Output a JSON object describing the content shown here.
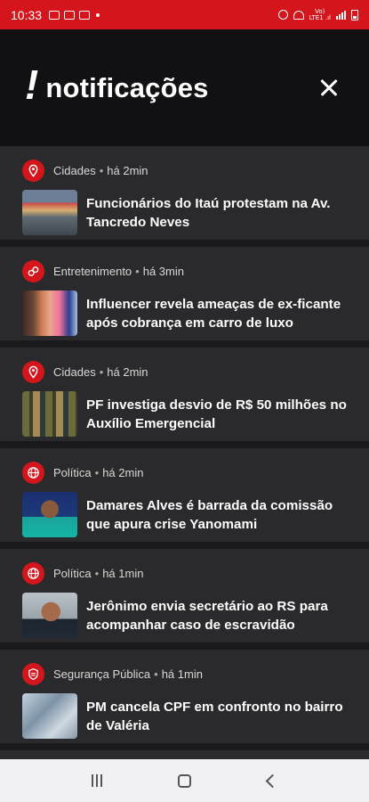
{
  "status_bar": {
    "time": "10:33",
    "carrier_line1": "Vo)",
    "carrier_line2": "LTE1 .ıl"
  },
  "header": {
    "brand_mark": "!",
    "title": "notificações"
  },
  "notifications": [
    {
      "category": "Cidades",
      "time": "há 2min",
      "icon": "location-pin-icon",
      "headline": "Funcionários do Itaú protestam na Av. Tancredo Neves"
    },
    {
      "category": "Entretenimento",
      "time": "há 3min",
      "icon": "entertainment-icon",
      "headline": "Influencer revela ameaças de ex-ficante após cobrança em carro de luxo"
    },
    {
      "category": "Cidades",
      "time": "há 2min",
      "icon": "location-pin-icon",
      "headline": "PF investiga desvio de R$ 50 milhões no Auxílio Emergencial"
    },
    {
      "category": "Política",
      "time": "há 2min",
      "icon": "globe-icon",
      "headline": "Damares Alves é barrada da comissão que apura crise Yanomami"
    },
    {
      "category": "Política",
      "time": "há 1min",
      "icon": "globe-icon",
      "headline": "Jerônimo envia secretário ao RS para acompanhar caso de escravidão"
    },
    {
      "category": "Segurança Pública",
      "time": "há 1min",
      "icon": "shield-icon",
      "headline": "PM cancela CPF em confronto no bairro de Valéria"
    }
  ],
  "colors": {
    "accent": "#d4161c",
    "header_bg": "#111113",
    "card_bg": "#2a2a2c"
  }
}
